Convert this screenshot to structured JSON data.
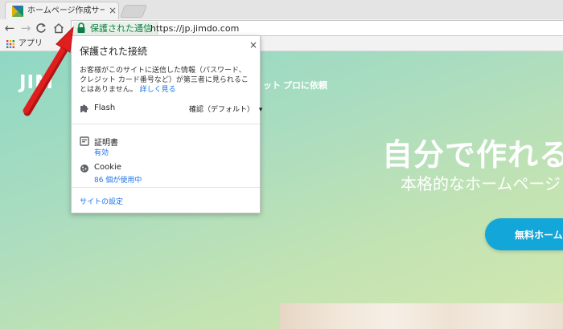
{
  "browser": {
    "tab": {
      "title": "ホームページ作成サービス - J",
      "close_glyph": "×",
      "favicon": "jimdo-favicon"
    },
    "toolbar": {
      "back_glyph": "←",
      "forward_glyph": "→",
      "reload_glyph": "C",
      "home_glyph": "⌂"
    },
    "omnibox": {
      "security_label": "保護された通信",
      "url": "https://jp.jimdo.com"
    },
    "bookmarks": {
      "apps_label": "アプリ"
    }
  },
  "popup": {
    "title": "保護された接続",
    "close_glyph": "×",
    "description": "お客様がこのサイトに送信した情報（パスワード、クレジット カード番号など）が第三者に見られることはありません。",
    "more_link": "詳しく見る",
    "flash": {
      "label": "Flash",
      "value": "確認（デフォルト）",
      "caret": "▾"
    },
    "certificate": {
      "label": "証明書",
      "status": "有効"
    },
    "cookie": {
      "label": "Cookie",
      "status": "86 個が使用中"
    },
    "site_settings": "サイトの設定"
  },
  "page": {
    "logo": "JIM",
    "nav_fragment": "ット",
    "nav_pro": "プロに依頼",
    "hero_title": "自分で作れる",
    "hero_subtitle": "本格的なホームページ",
    "cta_label": "無料ホーム"
  },
  "colors": {
    "secure_green": "#0b8043",
    "link_blue": "#1a73e8",
    "cta_blue": "#13a6d8",
    "arrow_red": "#e01e1e"
  }
}
